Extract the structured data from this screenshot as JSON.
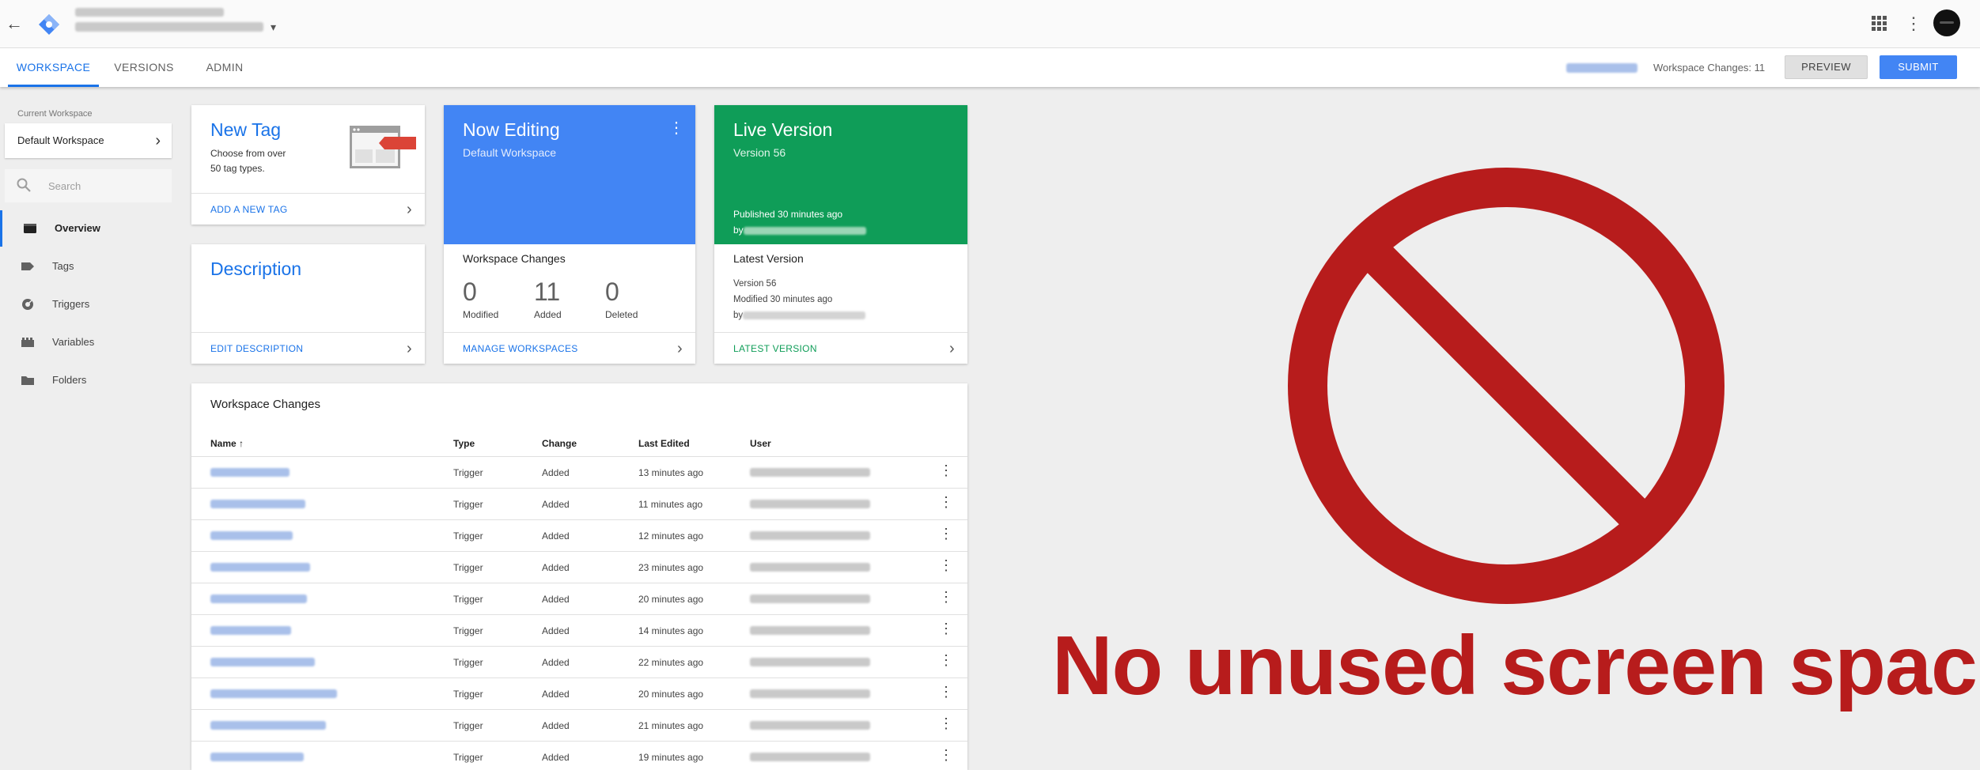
{
  "header": {
    "back_icon": "arrow-back-icon",
    "logo": "gtm-logo-icon",
    "apps_icon": "apps-grid-icon",
    "more_icon": "more-vert-icon",
    "avatar_icon": "avatar"
  },
  "tabs": [
    {
      "label": "WORKSPACE",
      "active": true
    },
    {
      "label": "VERSIONS",
      "active": false
    },
    {
      "label": "ADMIN",
      "active": false
    }
  ],
  "toolbar": {
    "workspace_changes": "Workspace Changes: 11",
    "preview_label": "PREVIEW",
    "submit_label": "SUBMIT",
    "submit_color": "#4285f4"
  },
  "sidebar": {
    "current_workspace_label": "Current Workspace",
    "current_workspace": "Default Workspace",
    "search_placeholder": "Search",
    "items": [
      {
        "label": "Overview",
        "icon": "overview-icon",
        "active": true
      },
      {
        "label": "Tags",
        "icon": "tag-icon",
        "active": false
      },
      {
        "label": "Triggers",
        "icon": "trigger-icon",
        "active": false
      },
      {
        "label": "Variables",
        "icon": "variables-icon",
        "active": false
      },
      {
        "label": "Folders",
        "icon": "folder-icon",
        "active": false
      }
    ]
  },
  "cards": {
    "new_tag": {
      "title": "New Tag",
      "description": "Choose from over 50 tag types.",
      "action": "ADD A NEW TAG"
    },
    "description": {
      "title": "Description",
      "action": "EDIT DESCRIPTION"
    },
    "now_editing": {
      "title": "Now Editing",
      "subtitle": "Default Workspace",
      "changes_title": "Workspace Changes",
      "modified": "0",
      "modified_label": "Modified",
      "added": "11",
      "added_label": "Added",
      "deleted": "0",
      "deleted_label": "Deleted",
      "action": "MANAGE WORKSPACES",
      "color": "#4285f4"
    },
    "live_version": {
      "title": "Live Version",
      "subtitle": "Version 56",
      "published": "Published 30 minutes ago",
      "by": "by",
      "latest_title": "Latest Version",
      "latest_version": "Version 56",
      "latest_modified": "Modified 30 minutes ago",
      "latest_by": "by",
      "action": "LATEST VERSION",
      "color": "#0f9d58"
    }
  },
  "changes_table": {
    "title": "Workspace Changes",
    "columns": {
      "name": "Name",
      "type": "Type",
      "change": "Change",
      "last_edited": "Last Edited",
      "user": "User"
    },
    "sort_icon": "arrow-upward-icon",
    "rows": [
      {
        "type": "Trigger",
        "change": "Added",
        "last_edited": "13 minutes ago"
      },
      {
        "type": "Trigger",
        "change": "Added",
        "last_edited": "11 minutes ago"
      },
      {
        "type": "Trigger",
        "change": "Added",
        "last_edited": "12 minutes ago"
      },
      {
        "type": "Trigger",
        "change": "Added",
        "last_edited": "23 minutes ago"
      },
      {
        "type": "Trigger",
        "change": "Added",
        "last_edited": "20 minutes ago"
      },
      {
        "type": "Trigger",
        "change": "Added",
        "last_edited": "14 minutes ago"
      },
      {
        "type": "Trigger",
        "change": "Added",
        "last_edited": "22 minutes ago"
      },
      {
        "type": "Trigger",
        "change": "Added",
        "last_edited": "20 minutes ago"
      },
      {
        "type": "Trigger",
        "change": "Added",
        "last_edited": "21 minutes ago"
      },
      {
        "type": "Trigger",
        "change": "Added",
        "last_edited": "19 minutes ago"
      }
    ]
  },
  "overlay": {
    "sign_icon": "prohibited-sign-icon",
    "slogan": "No unused screen space.",
    "color": "#b71c1c"
  }
}
